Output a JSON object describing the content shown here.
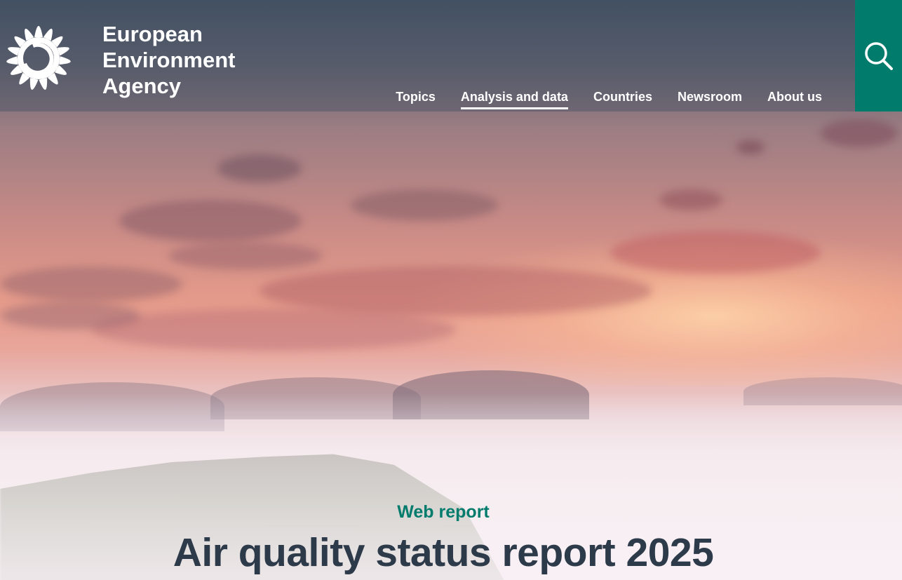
{
  "header": {
    "brand_line1": "European",
    "brand_line2": "Environment",
    "brand_line3": "Agency",
    "nav": [
      {
        "label": "Topics"
      },
      {
        "label": "Analysis and data"
      },
      {
        "label": "Countries"
      },
      {
        "label": "Newsroom"
      },
      {
        "label": "About us"
      }
    ],
    "active_nav": "Analysis and data",
    "search_icon": "search-icon"
  },
  "hero": {
    "kicker": "Web report",
    "title": "Air quality status report 2025"
  },
  "colors": {
    "accent_green": "#007b6c",
    "title_text": "#2d3a4a",
    "nav_text": "#ffffff"
  }
}
